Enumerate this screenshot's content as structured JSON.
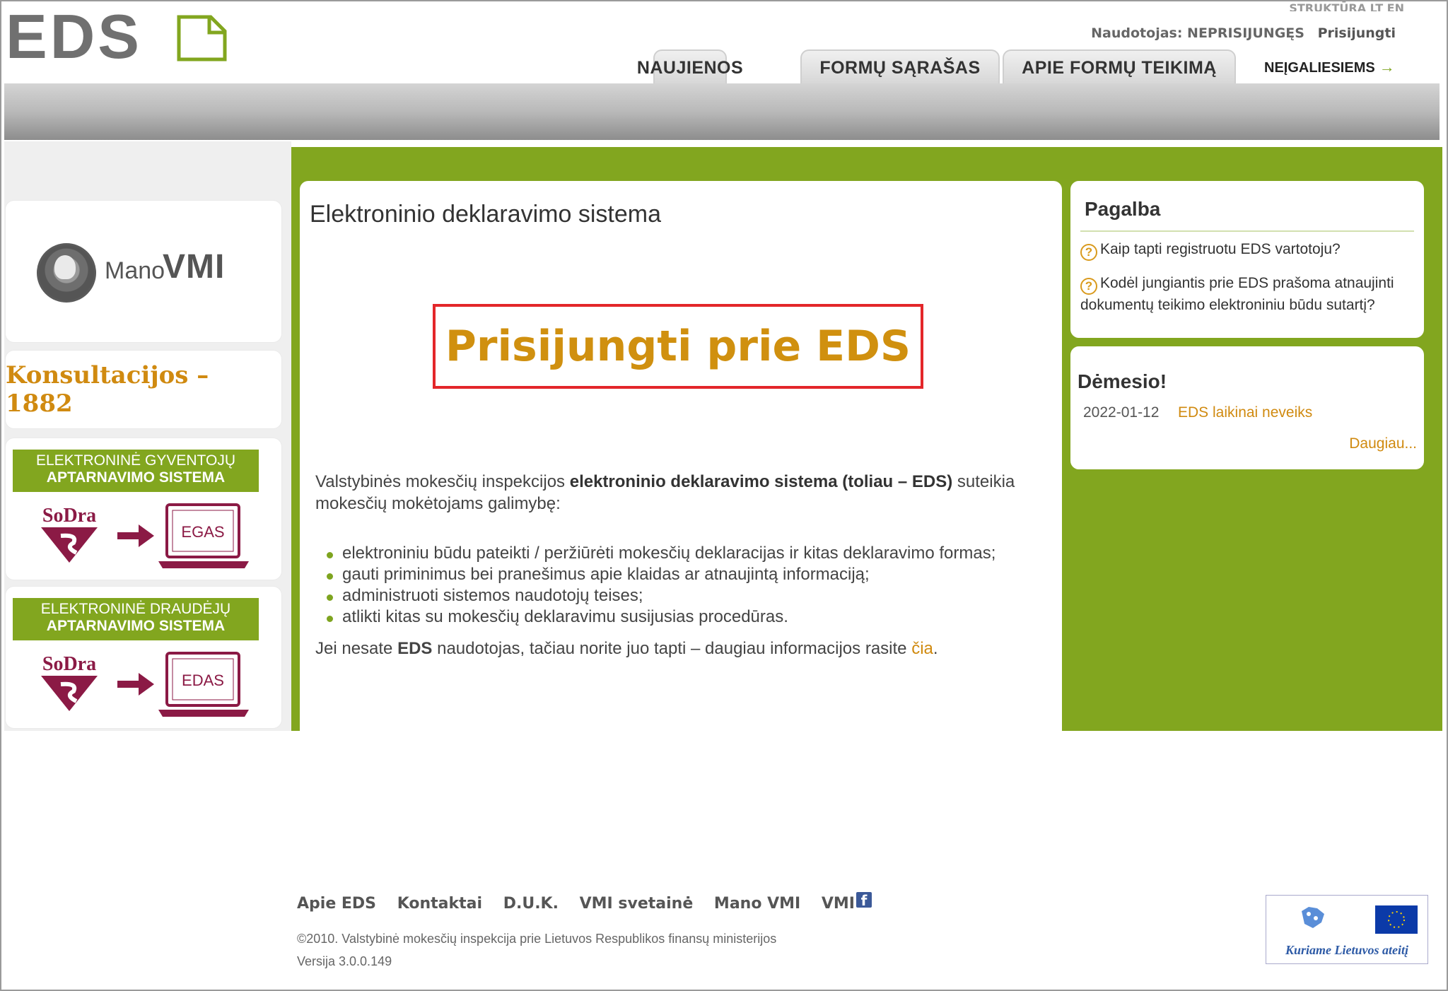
{
  "header": {
    "logo_text": "EDS",
    "top_links": "STRUKTŪRA   LT  EN",
    "user_label": "Naudotojas: NEPRISIJUNGĘS",
    "login_link": "Prisijungti",
    "tabs": [
      {
        "label": "NAUJIENOS"
      },
      {
        "label": "FORMŲ SĄRAŠAS"
      },
      {
        "label": "APIE FORMŲ TEIKIMĄ"
      }
    ],
    "accessibility_link": "NEĮGALIESIEMS",
    "accessibility_arrow": "→"
  },
  "sidebar": {
    "manovmi": {
      "prefix": "Mano",
      "brand": "VMI"
    },
    "consult": "Konsultacijos – 1882",
    "services": [
      {
        "line1": "ELEKTRONINĖ GYVENTOJŲ",
        "line2": "APTARNAVIMO SISTEMA",
        "sodra": "SoDra",
        "target": "EGAS"
      },
      {
        "line1": "ELEKTRONINĖ DRAUDĖJŲ",
        "line2": "APTARNAVIMO SISTEMA",
        "sodra": "SoDra",
        "target": "EDAS"
      }
    ]
  },
  "main": {
    "title": "Elektroninio deklaravimo sistema",
    "login_button": "Prisijungti prie EDS",
    "intro_start": "Valstybinės mokesčių inspekcijos ",
    "intro_bold": "elektroninio deklaravimo sistema (toliau – EDS)",
    "intro_end": " suteikia mokesčių mokėtojams galimybę:",
    "bullets": [
      "elektroniniu būdu pateikti / peržiūrėti mokesčių deklaracijas ir kitas deklaravimo formas;",
      "gauti priminimus bei pranešimus apie klaidas ar atnaujintą informaciją;",
      "administruoti sistemos naudotojų teises;",
      "atlikti kitas su mokesčių deklaravimu susijusias procedūras."
    ],
    "info_start": "Jei nesate ",
    "info_bold": "EDS",
    "info_mid": " naudotojas, tačiau norite juo tapti – daugiau informacijos rasite ",
    "info_link": "čia",
    "info_end": "."
  },
  "help": {
    "title": "Pagalba",
    "questions": [
      "Kaip tapti registruotu EDS vartotoju?",
      "Kodėl jungiantis prie EDS prašoma atnaujinti dokumentų teikimo elektroniniu būdu sutartį?"
    ]
  },
  "notice": {
    "title": "Dėmesio!",
    "date": "2022-01-12",
    "item": "EDS laikinai neveiks",
    "more": "Daugiau..."
  },
  "footer": {
    "links": [
      "Apie EDS",
      "Kontaktai",
      "D.U.K.",
      "VMI svetainė",
      "Mano VMI",
      "VMI"
    ],
    "copyright": "©2010. Valstybinė mokesčių inspekcija prie Lietuvos Respublikos finansų ministerijos",
    "version": "Versija 3.0.0.149",
    "eu_caption": "Kuriame Lietuvos ateitį"
  },
  "colors": {
    "green": "#82a61f",
    "orange": "#d08a10",
    "red_border": "#e3262a",
    "sodra": "#8b1a45"
  }
}
